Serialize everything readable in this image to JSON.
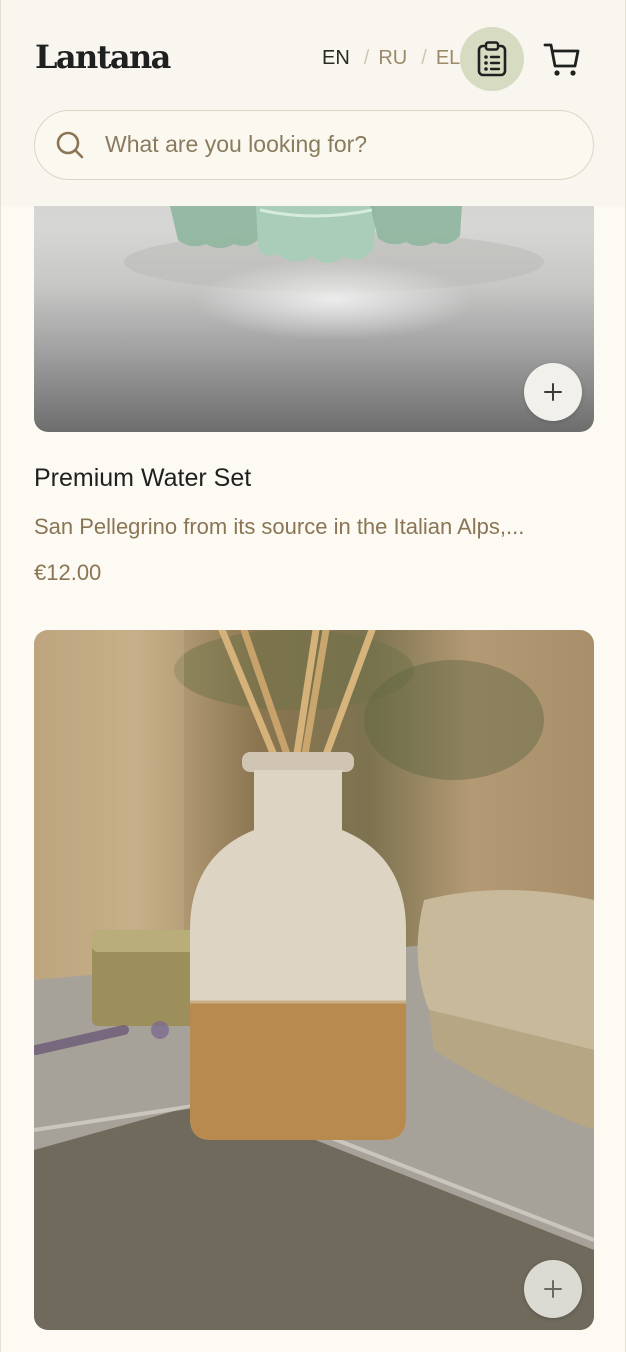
{
  "header": {
    "logo": "Lantana",
    "languages": [
      {
        "code": "EN",
        "active": true
      },
      {
        "code": "RU",
        "active": false
      },
      {
        "code": "EL",
        "active": false
      }
    ],
    "separator": "/",
    "icons": {
      "list": "clipboard-list-icon",
      "cart": "shopping-cart-icon",
      "search": "search-icon"
    }
  },
  "search": {
    "placeholder": "What are you looking for?",
    "value": ""
  },
  "products": [
    {
      "title": "Premium Water Set",
      "description": "San Pellegrino from its source in the Italian Alps,...",
      "price": "€12.00",
      "add_icon": "plus-icon"
    },
    {
      "title": "",
      "description": "",
      "price": "",
      "add_icon": "plus-icon"
    }
  ],
  "colors": {
    "background": "#fcfaf3",
    "accent_circle": "#d7dbc2",
    "muted_text": "#8a7554",
    "dark_text": "#1f2120"
  }
}
